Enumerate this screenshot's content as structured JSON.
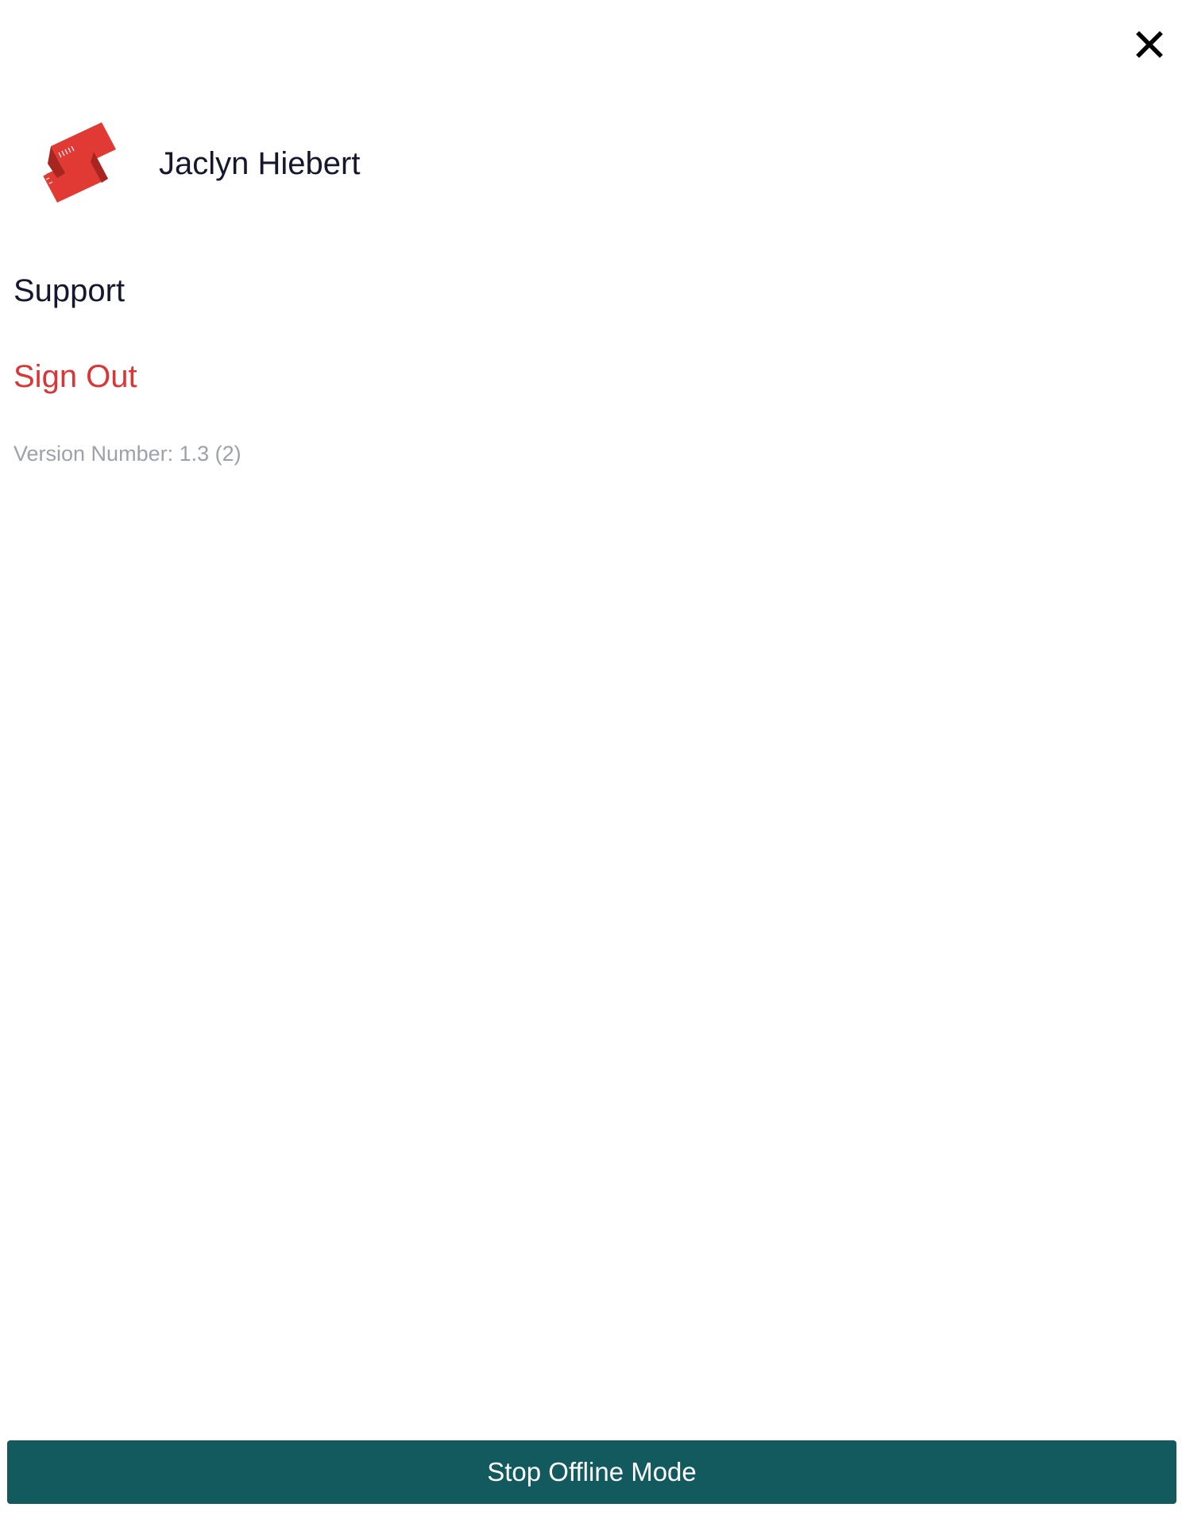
{
  "header": {
    "close_icon": "close-icon"
  },
  "profile": {
    "logo_icon": "ticket-logo-icon",
    "name": "Jaclyn Hiebert"
  },
  "menu": {
    "support_label": "Support",
    "sign_out_label": "Sign Out",
    "version_text": "Version Number: 1.3 (2)"
  },
  "footer": {
    "offline_button_label": "Stop Offline Mode"
  },
  "colors": {
    "primary_text": "#15172e",
    "danger": "#db3535",
    "muted": "#9ea1ab",
    "button_bg": "#135a5e",
    "button_text": "#ffffff",
    "logo": "#e13a35"
  }
}
